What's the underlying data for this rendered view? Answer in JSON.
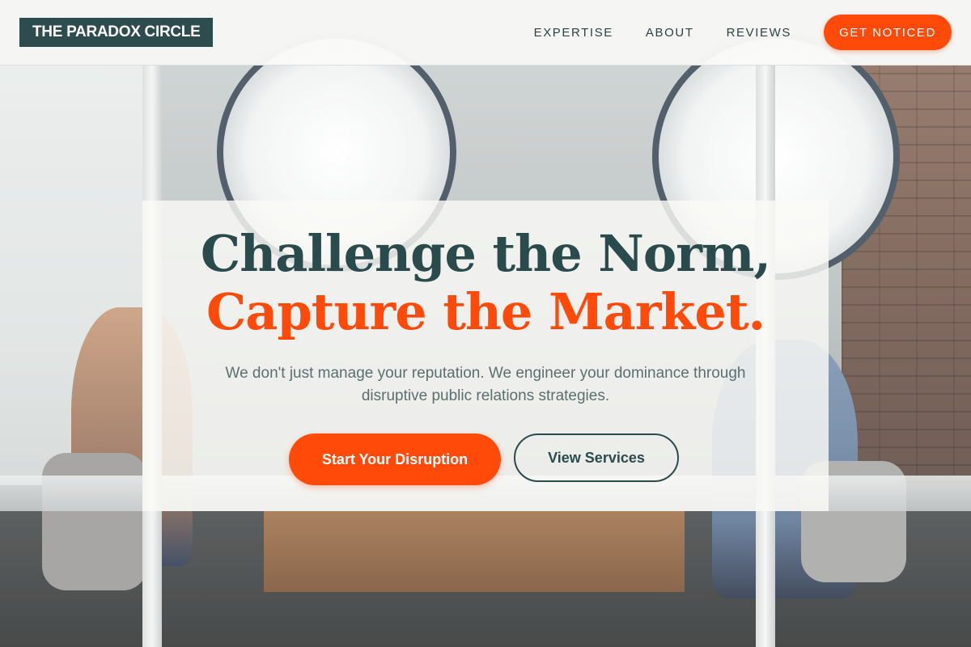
{
  "header": {
    "logo": "THE PARADOX CIRCLE",
    "nav": [
      "EXPERTISE",
      "ABOUT",
      "REVIEWS"
    ],
    "cta": "GET NOTICED"
  },
  "hero": {
    "headline_line1": "Challenge the Norm,",
    "headline_line2": "Capture the Market.",
    "subtext": "We don't just manage your reputation. We engineer your dominance through disruptive public relations strategies.",
    "primary_button": "Start Your Disruption",
    "secondary_button": "View Services"
  },
  "colors": {
    "brand_dark": "#2b4a4c",
    "accent": "#ff4a0a",
    "header_bg": "#fafaf8"
  }
}
